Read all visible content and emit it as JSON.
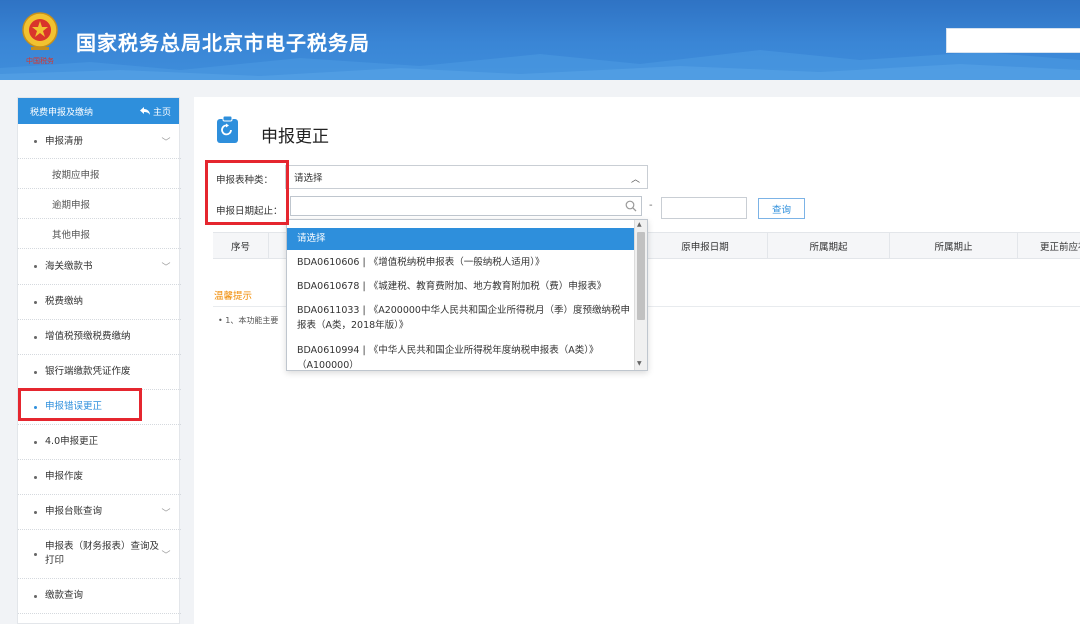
{
  "header": {
    "site_title": "国家税务总局北京市电子税务局",
    "emblem_text": "中国税务"
  },
  "sidebar": {
    "heading": "税费申报及缴纳",
    "home_label": "主页",
    "items": [
      {
        "label": "申报清册",
        "has_chevron": true
      },
      {
        "label": "按期应申报",
        "sub": true
      },
      {
        "label": "逾期申报",
        "sub": true
      },
      {
        "label": "其他申报",
        "sub": true
      },
      {
        "label": "海关缴款书",
        "has_chevron": true
      },
      {
        "label": "税费缴纳"
      },
      {
        "label": "增值税预缴税费缴纳"
      },
      {
        "label": "银行端缴款凭证作废"
      },
      {
        "label": "申报错误更正",
        "active": true
      },
      {
        "label": "4.0申报更正"
      },
      {
        "label": "申报作废"
      },
      {
        "label": "申报台账查询",
        "has_chevron": true
      },
      {
        "label": "申报表（财务报表）查询及打印",
        "has_chevron": true
      },
      {
        "label": "缴款查询"
      }
    ]
  },
  "main": {
    "page_title": "申报更正",
    "form": {
      "type_label": "申报表种类：",
      "type_value": "请选择",
      "date_label": "申报日期起止：",
      "date_separator": "-",
      "query_button": "查询"
    },
    "table_headers": [
      "序号",
      "原申报日期",
      "所属期起",
      "所属期止",
      "更正前应补退金额"
    ],
    "tip_title": "温馨提示",
    "tip_text": "• 1、本功能主要"
  },
  "dropdown": {
    "options": [
      "请选择",
      "BDA0610606 | 《增值税纳税申报表（一般纳税人适用）》",
      "BDA0610678 | 《城建税、教育费附加、地方教育附加税（费）申报表》",
      "BDA0611033 | 《A200000中华人民共和国企业所得税月（季）度预缴纳税申报表（A类，2018年版）》",
      "BDA0610994 | 《中华人民共和国企业所得税年度纳税申报表（A类）》（A100000）"
    ],
    "selected_index": 0
  },
  "colors": {
    "brand_blue": "#2e8fdc",
    "highlight_red": "#e5262f",
    "tip_orange": "#f08a00"
  }
}
